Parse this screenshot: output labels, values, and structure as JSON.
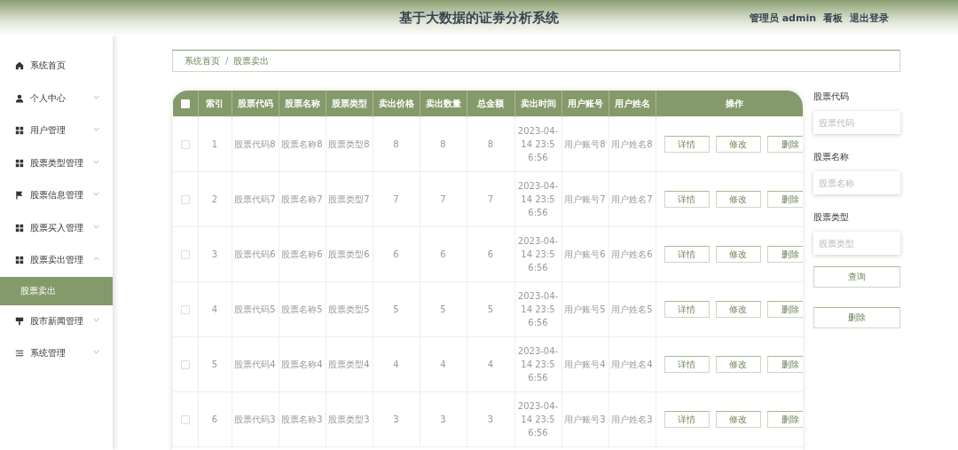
{
  "header": {
    "title": "基于大数据的证券分析系统",
    "user_role": "管理员",
    "user_name": "admin",
    "links": [
      "看板",
      "退出登录"
    ]
  },
  "sidebar": {
    "items": [
      {
        "label": "系统首页"
      },
      {
        "label": "个人中心",
        "expanded": false
      },
      {
        "label": "用户管理",
        "expanded": false
      },
      {
        "label": "股票类型管理",
        "expanded": false
      },
      {
        "label": "股票信息管理",
        "expanded": false
      },
      {
        "label": "股票买入管理",
        "expanded": false
      },
      {
        "label": "股票卖出管理",
        "expanded": true,
        "children": [
          {
            "label": "股票卖出",
            "selected": true
          }
        ]
      },
      {
        "label": "股市新闻管理",
        "expanded": false
      },
      {
        "label": "系统管理",
        "expanded": false
      }
    ]
  },
  "breadcrumb": {
    "separator": "/",
    "items": [
      "系统首页",
      "股票卖出"
    ]
  },
  "table": {
    "select_all_checked": false,
    "columns": [
      "索引",
      "股票代码",
      "股票名称",
      "股票类型",
      "卖出价格",
      "卖出数量",
      "总金额",
      "卖出时间",
      "用户账号",
      "用户姓名",
      "操作"
    ],
    "rows": [
      {
        "checked": false,
        "cells": [
          "1",
          "股票代码8",
          "股票名称8",
          "股票类型8",
          "8",
          "8",
          "8",
          "2023-04-14 23:56:56",
          "用户账号8",
          "用户姓名8"
        ],
        "actions": [
          "详情",
          "修改",
          "删除"
        ]
      },
      {
        "checked": false,
        "cells": [
          "2",
          "股票代码7",
          "股票名称7",
          "股票类型7",
          "7",
          "7",
          "7",
          "2023-04-14 23:56:56",
          "用户账号7",
          "用户姓名7"
        ],
        "actions": [
          "详情",
          "修改",
          "删除"
        ]
      },
      {
        "checked": false,
        "cells": [
          "3",
          "股票代码6",
          "股票名称6",
          "股票类型6",
          "6",
          "6",
          "6",
          "2023-04-14 23:56:56",
          "用户账号6",
          "用户姓名6"
        ],
        "actions": [
          "详情",
          "修改",
          "删除"
        ]
      },
      {
        "checked": false,
        "cells": [
          "4",
          "股票代码5",
          "股票名称5",
          "股票类型5",
          "5",
          "5",
          "5",
          "2023-04-14 23:56:56",
          "用户账号5",
          "用户姓名5"
        ],
        "actions": [
          "详情",
          "修改",
          "删除"
        ]
      },
      {
        "checked": false,
        "cells": [
          "5",
          "股票代码4",
          "股票名称4",
          "股票类型4",
          "4",
          "4",
          "4",
          "2023-04-14 23:56:56",
          "用户账号4",
          "用户姓名4"
        ],
        "actions": [
          "详情",
          "修改",
          "删除"
        ]
      },
      {
        "checked": false,
        "cells": [
          "6",
          "股票代码3",
          "股票名称3",
          "股票类型3",
          "3",
          "3",
          "3",
          "2023-04-14 23:56:56",
          "用户账号3",
          "用户姓名3"
        ],
        "actions": [
          "详情",
          "修改",
          "删除"
        ]
      }
    ]
  },
  "search_panel": {
    "fields": [
      {
        "label": "股票代码",
        "placeholder": "股票代码"
      },
      {
        "label": "股票名称",
        "placeholder": "股票名称"
      },
      {
        "label": "股票类型",
        "placeholder": "股票类型"
      }
    ],
    "buttons": [
      "查询",
      "删除"
    ]
  }
}
